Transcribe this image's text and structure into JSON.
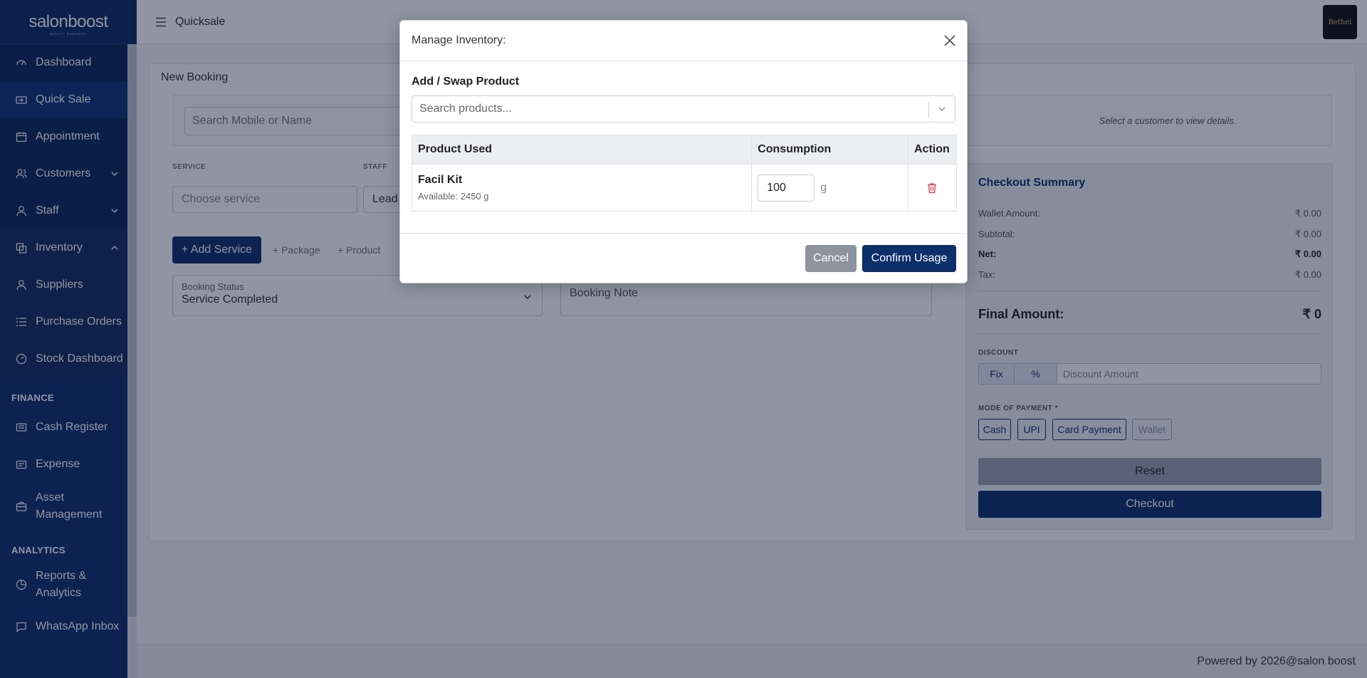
{
  "brand": {
    "logo_text": "salonboost",
    "tagline": "BEAUTY BUSINESS"
  },
  "sidebar": {
    "items": [
      {
        "label": "Dashboard",
        "icon": "gauge-icon"
      },
      {
        "label": "Quick Sale",
        "icon": "cash-icon"
      },
      {
        "label": "Appointment",
        "icon": "calendar-icon"
      },
      {
        "label": "Customers",
        "icon": "users-icon"
      },
      {
        "label": "Staff",
        "icon": "user-icon"
      },
      {
        "label": "Inventory",
        "icon": "boxes-icon"
      },
      {
        "label": "Suppliers",
        "icon": "users-icon"
      },
      {
        "label": "Purchase Orders",
        "icon": "list-icon"
      },
      {
        "label": "Stock Dashboard",
        "icon": "gauge-icon"
      }
    ],
    "finance_heading": "FINANCE",
    "finance_items": [
      {
        "label": "Cash Register"
      },
      {
        "label": "Expense"
      },
      {
        "label": "Asset Management"
      }
    ],
    "analytics_heading": "ANALYTICS",
    "analytics_items": [
      {
        "label": "Reports & Analytics"
      },
      {
        "label": "WhatsApp Inbox"
      }
    ]
  },
  "topbar": {
    "title": "Quicksale",
    "avatar_text": "Bethel"
  },
  "booking": {
    "title": "New Booking",
    "search_placeholder": "Search Mobile or Name",
    "customer_note": "Select a customer to view details.",
    "service_label": "SERVICE",
    "staff_label": "STAFF",
    "service_placeholder": "Choose service",
    "staff_value": "Lead",
    "add_service": "+ Add Service",
    "add_package": "+ Package",
    "add_product": "+ Product",
    "status_label": "Booking Status",
    "status_value": "Service Completed",
    "note_placeholder": "Booking Note"
  },
  "checkout": {
    "title": "Checkout Summary",
    "rows": [
      {
        "label": "Wallet Amount:",
        "value": "₹ 0.00"
      },
      {
        "label": "Subtotal:",
        "value": "₹ 0.00"
      },
      {
        "label": "Net:",
        "value": "₹ 0.00"
      },
      {
        "label": "Tax:",
        "value": "₹ 0.00"
      }
    ],
    "final_label": "Final Amount:",
    "final_value": "₹ 0",
    "discount_label": "DISCOUNT",
    "fix_label": "Fix",
    "percent_label": "%",
    "discount_placeholder": "Discount Amount",
    "payment_label": "MODE OF PAYMENT *",
    "payments": [
      "Cash",
      "UPI",
      "Card Payment",
      "Wallet"
    ],
    "reset": "Reset",
    "checkout": "Checkout"
  },
  "footer": {
    "text": "Powered by 2026@salon boost"
  },
  "modal": {
    "title": "Manage Inventory:",
    "subheading": "Add / Swap Product",
    "search_placeholder": "Search products...",
    "columns": [
      "Product Used",
      "Consumption",
      "Action"
    ],
    "rows": [
      {
        "name": "Facil Kit",
        "available": "Available: 2450 g",
        "consumption": "100",
        "unit": "g"
      }
    ],
    "cancel": "Cancel",
    "confirm": "Confirm Usage"
  },
  "colors": {
    "primary": "#0d2f6a",
    "danger": "#dc3545"
  }
}
